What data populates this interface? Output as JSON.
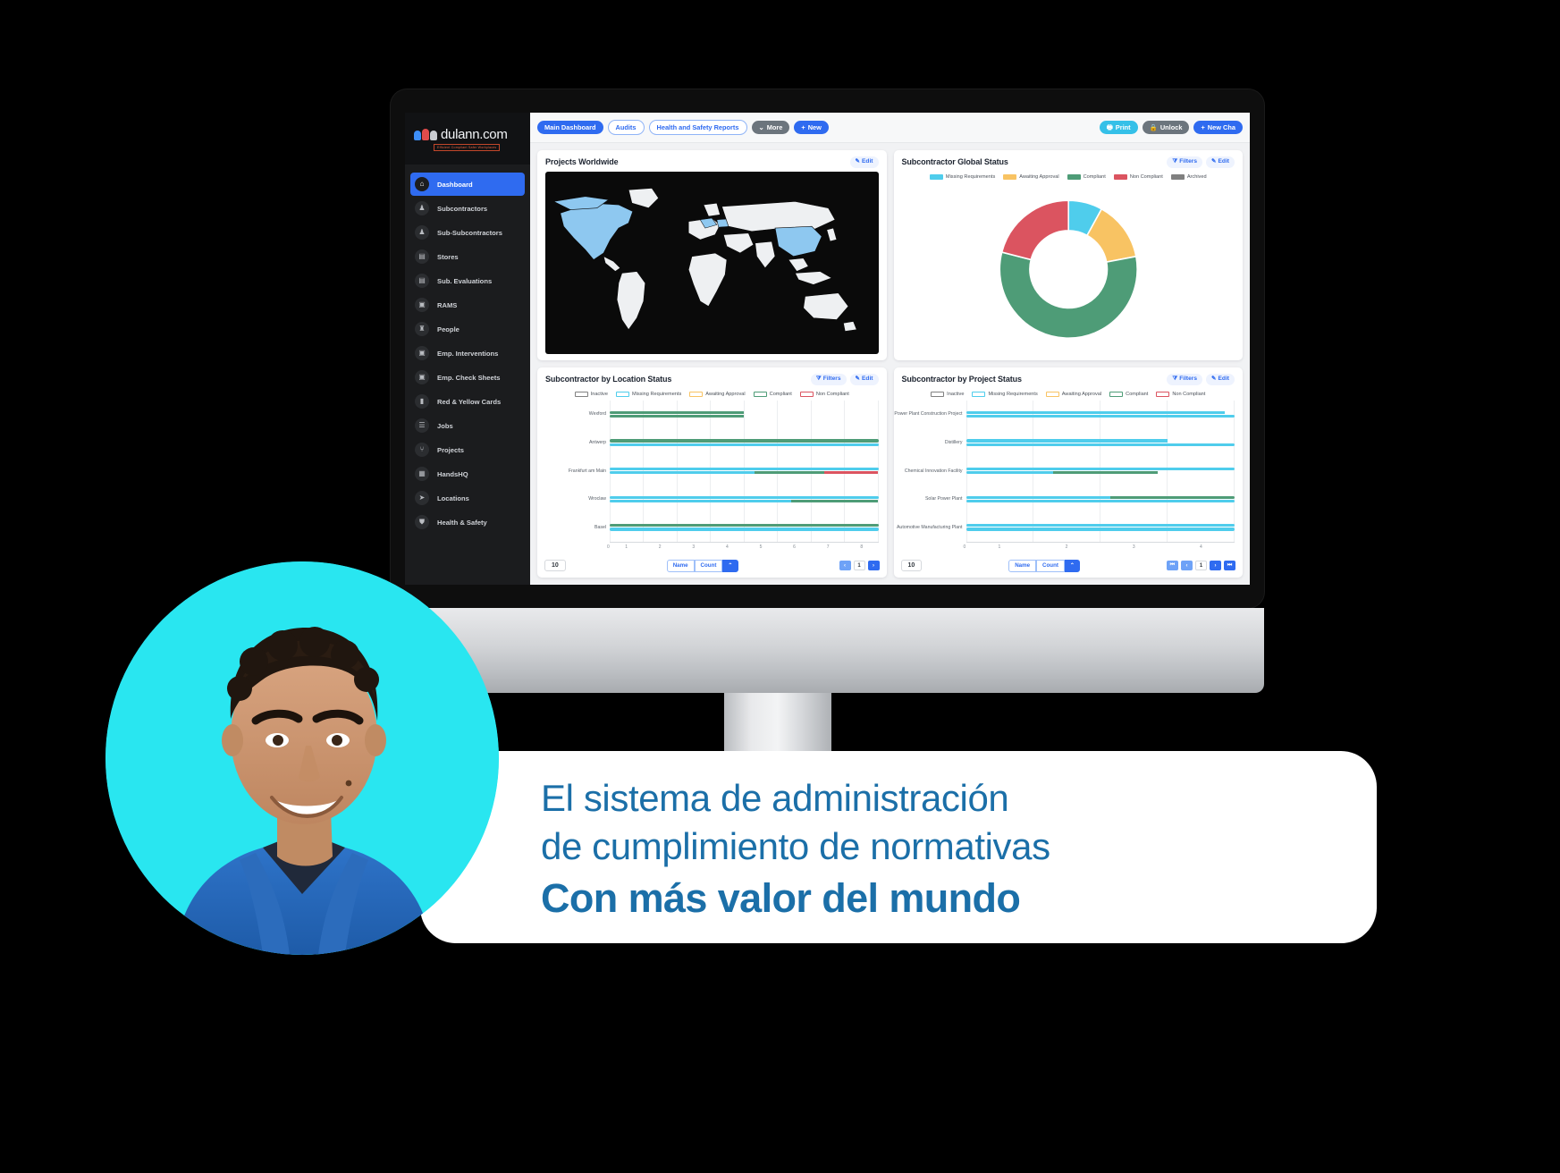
{
  "brand": {
    "name": "dulann.com",
    "tagline": "Efficient Compliant Safer Workplaces"
  },
  "sidebar": {
    "items": [
      {
        "label": "Dashboard",
        "icon": "home-icon",
        "active": true
      },
      {
        "label": "Subcontractors",
        "icon": "org-icon",
        "active": false
      },
      {
        "label": "Sub-Subcontractors",
        "icon": "org-icon",
        "active": false
      },
      {
        "label": "Stores",
        "icon": "store-icon",
        "active": false
      },
      {
        "label": "Sub. Evaluations",
        "icon": "clipboard-icon",
        "active": false
      },
      {
        "label": "RAMS",
        "icon": "document-icon",
        "active": false
      },
      {
        "label": "People",
        "icon": "people-icon",
        "active": false
      },
      {
        "label": "Emp. Interventions",
        "icon": "square-icon",
        "active": false
      },
      {
        "label": "Emp. Check Sheets",
        "icon": "square-icon",
        "active": false
      },
      {
        "label": "Red & Yellow Cards",
        "icon": "card-icon",
        "active": false
      },
      {
        "label": "Jobs",
        "icon": "list-icon",
        "active": false
      },
      {
        "label": "Projects",
        "icon": "hierarchy-icon",
        "active": false
      },
      {
        "label": "HandsHQ",
        "icon": "grid-icon",
        "active": false
      },
      {
        "label": "Locations",
        "icon": "pin-icon",
        "active": false
      },
      {
        "label": "Health & Safety",
        "icon": "shield-icon",
        "active": false
      }
    ]
  },
  "topbar": {
    "tabs": [
      {
        "label": "Main Dashboard",
        "style": "solid"
      },
      {
        "label": "Audits",
        "style": "outline"
      },
      {
        "label": "Health and Safety Reports",
        "style": "outline"
      }
    ],
    "more_label": "More",
    "new_label": "New",
    "print_label": "Print",
    "unlock_label": "Unlock",
    "new_chart_label": "New Cha"
  },
  "cards": {
    "map": {
      "title": "Projects Worldwide",
      "edit_label": "Edit"
    },
    "donut": {
      "title": "Subcontractor Global Status",
      "filters_label": "Filters",
      "edit_label": "Edit"
    },
    "location": {
      "title": "Subcontractor by Location Status",
      "filters_label": "Filters",
      "edit_label": "Edit",
      "page_size": "10",
      "sort_name": "Name",
      "sort_count": "Count",
      "page_current": "1"
    },
    "project": {
      "title": "Subcontractor by Project Status",
      "filters_label": "Filters",
      "edit_label": "Edit",
      "page_size": "10",
      "sort_name": "Name",
      "sort_count": "Count",
      "page_current": "1"
    }
  },
  "colors": {
    "missing_requirements": "#4FCDEC",
    "awaiting_approval": "#F8C363",
    "compliant": "#4E9C77",
    "non_compliant": "#DB5460",
    "archived": "#808080",
    "inactive": "#808080",
    "accent_blue": "#2f6bf0",
    "brand_cyan": "#29E6F0",
    "caption_blue": "#1b6fa8"
  },
  "chart_data": [
    {
      "type": "pie",
      "title": "Subcontractor Global Status",
      "legend_position": "top",
      "legend": [
        "Missing Requirements",
        "Awaiting Approval",
        "Compliant",
        "Non Compliant",
        "Archived"
      ],
      "categories": [
        "Missing Requirements",
        "Awaiting Approval",
        "Compliant",
        "Non Compliant",
        "Archived"
      ],
      "values": [
        8,
        14,
        57,
        21,
        0
      ],
      "colors": [
        "#4FCDEC",
        "#F8C363",
        "#4E9C77",
        "#DB5460",
        "#808080"
      ]
    },
    {
      "type": "bar",
      "title": "Subcontractor by Location Status",
      "orientation": "horizontal",
      "legend_position": "top",
      "legend": [
        "Inactive",
        "Missing Requirements",
        "Awaiting Approval",
        "Compliant",
        "Non Compliant"
      ],
      "xlabel": "",
      "ylabel": "",
      "xlim": [
        0,
        8
      ],
      "xticks": [
        "0",
        "1",
        "2",
        "3",
        "4",
        "5",
        "6",
        "7",
        "8"
      ],
      "grid": true,
      "categories": [
        "Wexford",
        "Antwerp",
        "Frankfurt am Main",
        "Wroclaw",
        "Basel"
      ],
      "series": [
        {
          "name": "Inactive",
          "color": "#808080",
          "values": [
            0,
            0,
            0,
            0,
            0
          ]
        },
        {
          "name": "Missing Requirements",
          "color": "#4FCDEC",
          "values": [
            0,
            8,
            8,
            3,
            8
          ]
        },
        {
          "name": "Awaiting Approval",
          "color": "#F8C363",
          "values": [
            0,
            0,
            0,
            0,
            0
          ]
        },
        {
          "name": "Compliant",
          "color": "#4E9C77",
          "values": [
            4,
            8,
            6,
            2,
            8
          ]
        },
        {
          "name": "Non Compliant",
          "color": "#DB5460",
          "values": [
            0,
            0,
            1.5,
            0,
            0
          ]
        }
      ],
      "bars": [
        {
          "category": "Wexford",
          "rows": [
            [
              {
                "c": "#4E9C77",
                "v": 4
              }
            ],
            [
              {
                "c": "#4E9C77",
                "v": 4
              }
            ]
          ]
        },
        {
          "category": "Antwerp",
          "rows": [
            [
              {
                "c": "#4E9C77",
                "v": 8
              }
            ],
            [
              {
                "c": "#4FCDEC",
                "v": 8
              }
            ]
          ]
        },
        {
          "category": "Frankfurt am Main",
          "rows": [
            [
              {
                "c": "#4FCDEC",
                "v": 8
              }
            ],
            [
              {
                "c": "#4FCDEC",
                "v": 4.3
              },
              {
                "c": "#4E9C77",
                "v": 2.1
              },
              {
                "c": "#DB5460",
                "v": 1.6
              }
            ]
          ]
        },
        {
          "category": "Wroclaw",
          "rows": [
            [
              {
                "c": "#4FCDEC",
                "v": 8
              }
            ],
            [
              {
                "c": "#4FCDEC",
                "v": 5.4
              },
              {
                "c": "#4E9C77",
                "v": 2.6
              }
            ]
          ]
        },
        {
          "category": "Basel",
          "rows": [
            [
              {
                "c": "#4E9C77",
                "v": 8
              }
            ],
            [
              {
                "c": "#4FCDEC",
                "v": 8
              }
            ]
          ]
        }
      ]
    },
    {
      "type": "bar",
      "title": "Subcontractor by Project Status",
      "orientation": "horizontal",
      "legend_position": "top",
      "legend": [
        "Inactive",
        "Missing Requirements",
        "Awaiting Approval",
        "Compliant",
        "Non Compliant"
      ],
      "xlabel": "",
      "ylabel": "",
      "xlim": [
        0,
        4
      ],
      "xticks": [
        "0",
        "1",
        "2",
        "3",
        "4"
      ],
      "grid": true,
      "categories": [
        "Power Plant Construction Project",
        "Distillery",
        "Chemical Innovation Facility",
        "Solar Power Plant",
        "Automotive Manufacturing Plant"
      ],
      "series": [
        {
          "name": "Inactive",
          "color": "#808080",
          "values": [
            0,
            0,
            0,
            0,
            0
          ]
        },
        {
          "name": "Missing Requirements",
          "color": "#4FCDEC",
          "values": [
            4,
            3,
            4,
            2,
            4
          ]
        },
        {
          "name": "Awaiting Approval",
          "color": "#F8C363",
          "values": [
            0,
            0,
            0,
            0,
            0
          ]
        },
        {
          "name": "Compliant",
          "color": "#4E9C77",
          "values": [
            0,
            0,
            2,
            2,
            0
          ]
        },
        {
          "name": "Non Compliant",
          "color": "#DB5460",
          "values": [
            0,
            0,
            0,
            0,
            0
          ]
        }
      ],
      "bars": [
        {
          "category": "Power Plant Construction Project",
          "rows": [
            [
              {
                "c": "#4FCDEC",
                "v": 3.85
              }
            ],
            [
              {
                "c": "#4FCDEC",
                "v": 4
              }
            ]
          ]
        },
        {
          "category": "Distillery",
          "rows": [
            [
              {
                "c": "#4FCDEC",
                "v": 3
              }
            ],
            [
              {
                "c": "#4FCDEC",
                "v": 4
              }
            ]
          ]
        },
        {
          "category": "Chemical Innovation Facility",
          "rows": [
            [
              {
                "c": "#4FCDEC",
                "v": 4
              }
            ],
            [
              {
                "c": "#4FCDEC",
                "v": 1.3
              },
              {
                "c": "#4E9C77",
                "v": 1.55
              }
            ]
          ]
        },
        {
          "category": "Solar Power Plant",
          "rows": [
            [
              {
                "c": "#4FCDEC",
                "v": 2.15
              },
              {
                "c": "#4E9C77",
                "v": 1.85
              }
            ],
            [
              {
                "c": "#4FCDEC",
                "v": 4
              }
            ]
          ]
        },
        {
          "category": "Automotive Manufacturing Plant",
          "rows": [
            [
              {
                "c": "#4FCDEC",
                "v": 4
              }
            ],
            [
              {
                "c": "#4FCDEC",
                "v": 4
              }
            ]
          ]
        }
      ]
    }
  ],
  "caption": {
    "line1": "El sistema de administración",
    "line2": "de cumplimiento de normativas",
    "line3": "Con más valor del mundo"
  }
}
